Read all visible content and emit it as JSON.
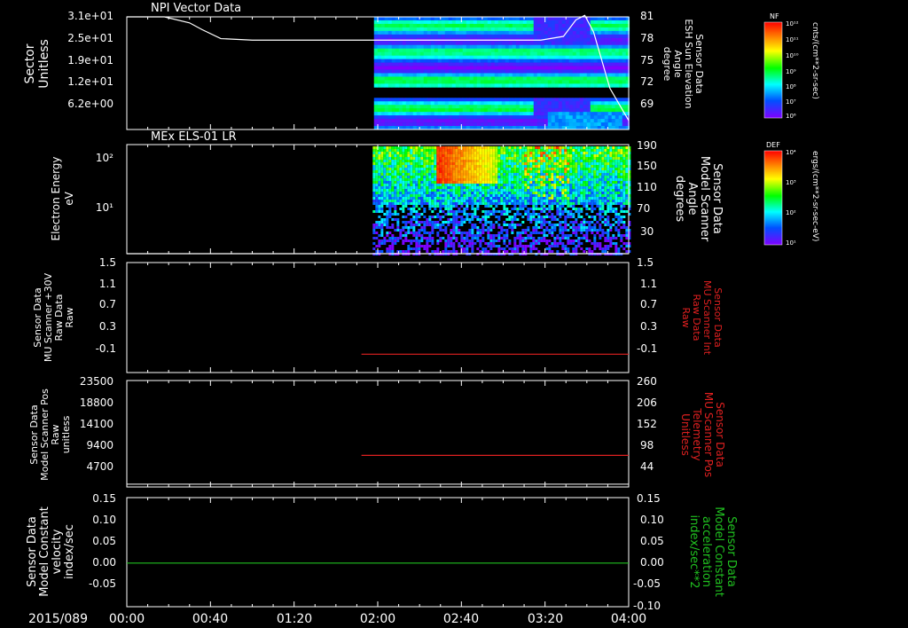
{
  "date_label": "2015/089",
  "time_ticks": [
    "00:00",
    "00:40",
    "01:20",
    "02:00",
    "02:40",
    "03:20",
    "04:00"
  ],
  "chart_data": [
    {
      "type": "heatmap",
      "title": "NPI Vector Data",
      "ylabel_left": [
        "Sector",
        "Unitless"
      ],
      "ylabel_right": [
        "Sensor Data",
        "ESH Sun Elevation",
        "Angle",
        "degree"
      ],
      "left_ticks": [
        "3.1e+01",
        "2.5e+01",
        "1.9e+01",
        "1.2e+01",
        "6.2e+00"
      ],
      "right_ticks": [
        "81",
        "78",
        "75",
        "72",
        "69"
      ],
      "x_range_hours": [
        0,
        4
      ],
      "data_start_hours": 1.97,
      "gaps": [
        {
          "sector_from": 10,
          "sector_to": 12
        }
      ],
      "overlay_line": {
        "axis": "right",
        "x_hours": [
          0,
          0.3,
          0.5,
          0.6,
          0.75,
          1.0,
          1.97,
          3.3,
          3.48,
          3.58,
          3.65,
          3.72,
          3.85,
          4.0
        ],
        "y_degrees": [
          81,
          81,
          80.2,
          79.3,
          78.1,
          77.9,
          77.9,
          77.9,
          78.4,
          80.6,
          81.2,
          79.0,
          71.5,
          67.2
        ]
      },
      "colorbar": {
        "label": "NF",
        "unit": "cnts/(cm**2-sr-sec)",
        "ticks": [
          "10¹²",
          "10¹¹",
          "10¹⁰",
          "10⁹",
          "10⁸",
          "10⁷",
          "10⁶"
        ]
      }
    },
    {
      "type": "heatmap",
      "title": "MEx ELS-01 LR",
      "ylabel_left": [
        "Electron Energy",
        "eV"
      ],
      "ylabel_right": [
        "Sensor Data",
        "Model Scanner",
        "Angle",
        "degrees"
      ],
      "left_ticks": [
        "10²",
        "10¹"
      ],
      "right_ticks": [
        "190",
        "150",
        "110",
        "70",
        "30"
      ],
      "x_range_hours": [
        0,
        4
      ],
      "data_start_hours": 1.96,
      "hot_spot_hours": [
        2.45,
        2.95
      ],
      "overlay_line": {
        "axis": "right",
        "y_degrees": 10
      },
      "colorbar": {
        "label": "DEF",
        "unit": "ergs/(cm**2-sr-sec-eV)",
        "ticks": [
          "10⁴",
          "10³",
          "10²",
          "10¹"
        ]
      }
    },
    {
      "type": "line",
      "ylabel_left": [
        "Sensor Data",
        "MU Scanner +30V",
        "Raw Data",
        "Raw"
      ],
      "ylabel_right": [
        "Sensor Data",
        "MU Scanner Int",
        "Raw Data",
        "Raw"
      ],
      "left_ticks": [
        "1.5",
        "1.1",
        "0.7",
        "0.3",
        "-0.1"
      ],
      "right_ticks": [
        "1.5",
        "1.1",
        "0.7",
        "0.3",
        "-0.1"
      ],
      "ylim": [
        -0.3,
        1.5
      ],
      "series": [
        {
          "axis": "right",
          "color": "#e02020",
          "x_start_hours": 1.87,
          "x_end_hours": 4.0,
          "y": 0.0
        }
      ]
    },
    {
      "type": "line",
      "ylabel_left": [
        "Sensor Data",
        "Model Scanner Pos",
        "Raw",
        "unitless"
      ],
      "ylabel_right": [
        "Sensor Data",
        "MU Scanner Pos",
        "Telemetry",
        "Unitless"
      ],
      "left_ticks": [
        "23500",
        "18800",
        "14100",
        "9400",
        "4700"
      ],
      "right_ticks": [
        "260",
        "206",
        "152",
        "98",
        "44"
      ],
      "ylim_left": [
        0,
        23500
      ],
      "ylim_right": [
        4,
        260
      ],
      "series": [
        {
          "axis": "right",
          "color": "#e02020",
          "x_start_hours": 1.87,
          "x_end_hours": 4.0,
          "y": 80
        },
        {
          "axis": "left",
          "color": "#ffffff",
          "x_start_hours": 0,
          "x_end_hours": 4.0,
          "y": 600
        }
      ]
    },
    {
      "type": "line",
      "ylabel_left": [
        "Sensor Data",
        "Model Constant",
        "velocity",
        "index/sec"
      ],
      "ylabel_right": [
        "Sensor Data",
        "Model Constant",
        "acceleration",
        "index/sec**2"
      ],
      "left_ticks": [
        "0.15",
        "0.10",
        "0.05",
        "0.00",
        "-0.05",
        "-0.10"
      ],
      "right_ticks": [
        "0.15",
        "0.10",
        "0.05",
        "0.00",
        "-0.05",
        "-0.10"
      ],
      "ylim": [
        -0.1,
        0.15
      ],
      "series": [
        {
          "axis": "right",
          "color": "#20c020",
          "x_start_hours": 0,
          "x_end_hours": 4.0,
          "y": 0.0
        }
      ]
    }
  ],
  "colors": {
    "axis": "#ffffff",
    "red": "#e02020",
    "green": "#20c020",
    "background": "#000000"
  }
}
